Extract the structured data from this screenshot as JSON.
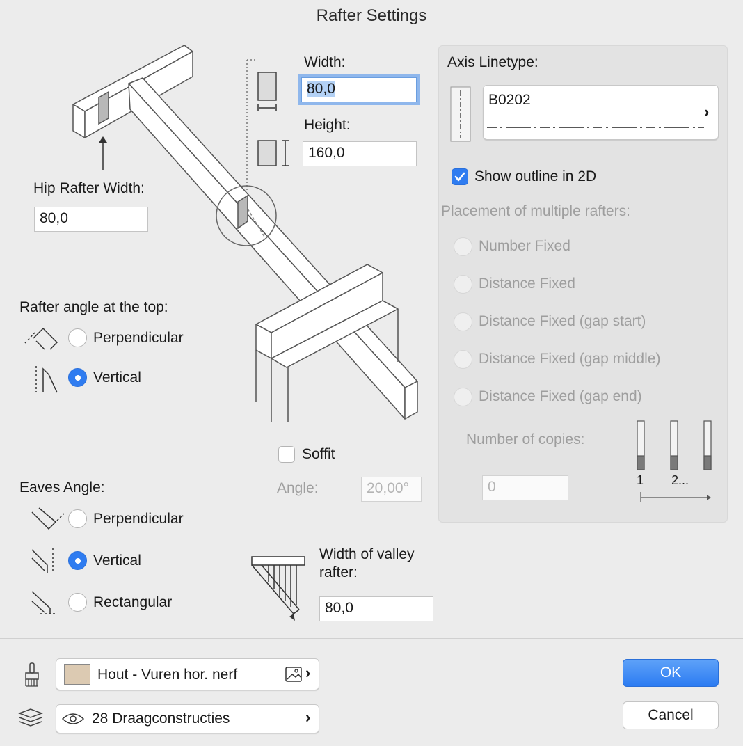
{
  "window": {
    "title": "Rafter Settings"
  },
  "size": {
    "width_label": "Width:",
    "width_value": "80,0",
    "height_label": "Height:",
    "height_value": "160,0"
  },
  "hip": {
    "label": "Hip Rafter Width:",
    "value": "80,0"
  },
  "top_angle": {
    "label": "Rafter angle at the top:",
    "options": [
      "Perpendicular",
      "Vertical"
    ],
    "selected": "Vertical"
  },
  "soffit": {
    "label": "Soffit",
    "checked": false,
    "angle_label": "Angle:",
    "angle_value": "20,00°"
  },
  "eaves": {
    "label": "Eaves Angle:",
    "options": [
      "Perpendicular",
      "Vertical",
      "Rectangular"
    ],
    "selected": "Vertical"
  },
  "valley": {
    "label_line1": "Width of valley",
    "label_line2": "rafter:",
    "value": "80,0"
  },
  "axis": {
    "label": "Axis Linetype:",
    "linetype_name": "B0202",
    "show_outline_label": "Show outline in 2D",
    "show_outline_checked": true
  },
  "placement": {
    "label": "Placement of multiple rafters:",
    "options": [
      "Number Fixed",
      "Distance Fixed",
      "Distance Fixed (gap start)",
      "Distance Fixed (gap middle)",
      "Distance Fixed (gap end)"
    ],
    "copies_label": "Number of copies:",
    "copies_value": "0",
    "diagram_labels": [
      "1",
      "2..."
    ]
  },
  "material": {
    "name": "Hout - Vuren hor. nerf",
    "swatch_color": "#dccab2"
  },
  "layer": {
    "name": "28 Draagconstructies"
  },
  "buttons": {
    "ok": "OK",
    "cancel": "Cancel"
  },
  "colors": {
    "accent": "#2f7cf0",
    "window_bg": "#ececec"
  }
}
